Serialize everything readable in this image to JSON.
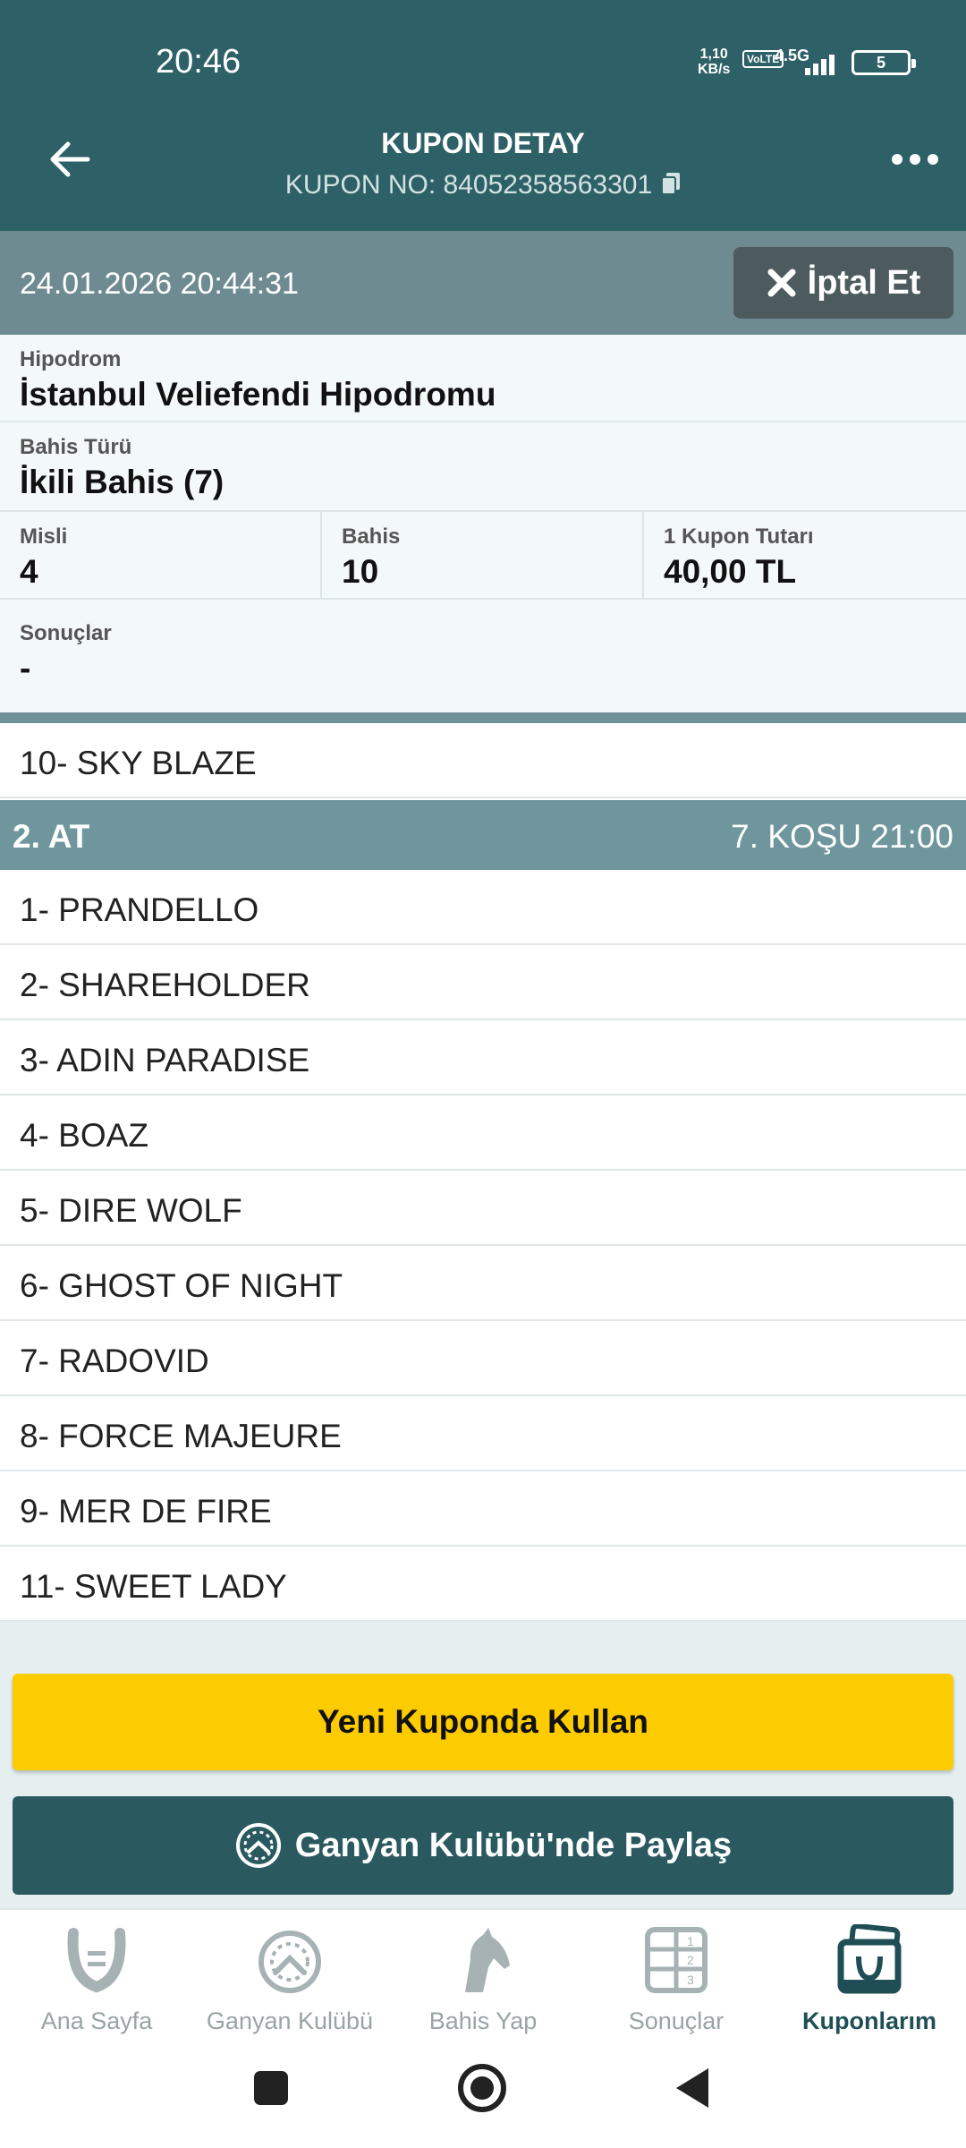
{
  "status": {
    "time": "20:46",
    "speed_value": "1,10",
    "speed_unit": "KB/s",
    "volte": "Vo LTE",
    "network": "4.5G",
    "battery": "5"
  },
  "header": {
    "title": "KUPON DETAY",
    "coupon_no": "KUPON NO: 84052358563301"
  },
  "datebar": {
    "datetime": "24.01.2026 20:44:31",
    "cancel_label": "İptal Et"
  },
  "details": {
    "hipodrom_label": "Hipodrom",
    "hipodrom_value": "İstanbul Veliefendi Hipodromu",
    "bahis_turu_label": "Bahis Türü",
    "bahis_turu_value": "İkili Bahis (7)",
    "misli_label": "Misli",
    "misli_value": "4",
    "bahis_label": "Bahis",
    "bahis_value": "10",
    "kupon_tutari_label": "1 Kupon Tutarı",
    "kupon_tutari_value": "40,00 TL",
    "sonuclar_label": "Sonuçlar",
    "sonuclar_value": "-"
  },
  "first_leg": {
    "horses": [
      "10- SKY BLAZE"
    ]
  },
  "second_leg": {
    "title": "2. AT",
    "race": "7. KOŞU 21:00",
    "horses": [
      "1- PRANDELLO",
      "2- SHAREHOLDER",
      "3- ADIN PARADISE",
      "4- BOAZ",
      "5- DIRE WOLF",
      "6- GHOST OF NIGHT",
      "7- RADOVID",
      "8- FORCE MAJEURE",
      "9- MER DE FIRE",
      "11- SWEET LADY"
    ]
  },
  "actions": {
    "reuse_label": "Yeni Kuponda Kullan",
    "share_label": "Ganyan Kulübü'nde Paylaş"
  },
  "bottom_nav": {
    "items": [
      {
        "label": "Ana Sayfa",
        "icon": "horseshoe-icon"
      },
      {
        "label": "Ganyan Kulübü",
        "icon": "club-gauge-icon"
      },
      {
        "label": "Bahis Yap",
        "icon": "horse-head-icon"
      },
      {
        "label": "Sonuçlar",
        "icon": "results-grid-icon"
      },
      {
        "label": "Kuponlarım",
        "icon": "coupons-icon"
      }
    ],
    "active_index": 4
  },
  "colors": {
    "primary": "#2e6167",
    "accent_yellow": "#fccb00",
    "section_header": "#6e969c"
  }
}
